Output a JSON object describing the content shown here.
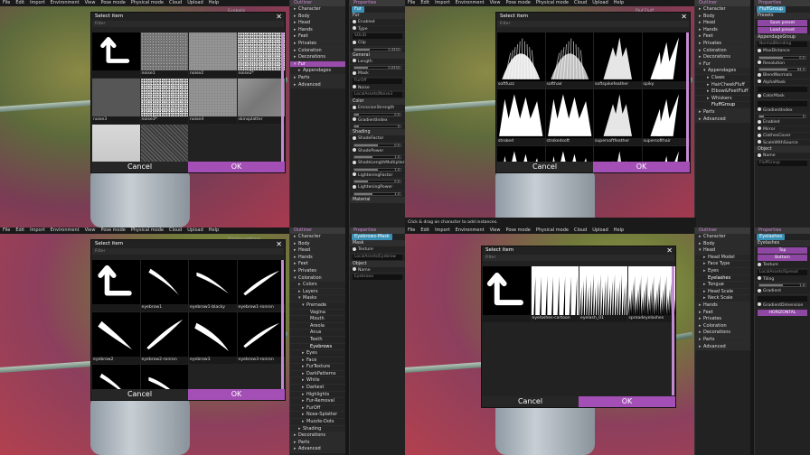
{
  "menu": [
    "File",
    "Edit",
    "Import",
    "Environment",
    "View",
    "Pose mode",
    "Physical mode",
    "Cloud",
    "Upload",
    "Help"
  ],
  "colors": {
    "accent": "#a34fb5",
    "selected": "#9a4cac",
    "chip": "#3a8fb5",
    "panel": "#222222"
  },
  "panels": {
    "outliner": "Outliner",
    "properties": "Properties"
  },
  "common": {
    "cancel": "Cancel",
    "ok": "OK",
    "filter": "Filter",
    "dialog_title": "Select item",
    "close": "✕"
  },
  "q0": {
    "outliner": [
      {
        "label": "Character",
        "level": 0,
        "chev": "▸"
      },
      {
        "label": "Body",
        "level": 0,
        "chev": "▸"
      },
      {
        "label": "Head",
        "level": 0,
        "chev": "▸"
      },
      {
        "label": "Hands",
        "level": 0,
        "chev": "▸"
      },
      {
        "label": "Feet",
        "level": 0,
        "chev": "▸"
      },
      {
        "label": "Privates",
        "level": 0,
        "chev": "▸"
      },
      {
        "label": "Coloration",
        "level": 0,
        "chev": "▸"
      },
      {
        "label": "Decorations",
        "level": 0,
        "chev": "▸"
      },
      {
        "label": "Fur",
        "level": 0,
        "chev": "▾",
        "selected": true
      },
      {
        "label": "Appendages",
        "level": 1,
        "chev": "▸"
      },
      {
        "label": "Parts",
        "level": 0,
        "chev": "▸"
      },
      {
        "label": "Advanced",
        "level": 0,
        "chev": "▸"
      }
    ],
    "props_chip": "Fur",
    "props": [
      {
        "type": "sect",
        "label": "Fur"
      },
      {
        "type": "row",
        "label": "Enabled"
      },
      {
        "type": "row",
        "label": "Type"
      },
      {
        "type": "field",
        "label": "SOLID"
      },
      {
        "type": "row",
        "label": "Clip"
      },
      {
        "type": "bar",
        "value": 0.3333,
        "text": "0.3333"
      },
      {
        "type": "sect",
        "label": "General"
      },
      {
        "type": "row",
        "label": "Length"
      },
      {
        "type": "bar",
        "value": 0.3,
        "text": "0.0334"
      },
      {
        "type": "row",
        "label": "Mask"
      },
      {
        "type": "field",
        "label": "FurOff"
      },
      {
        "type": "row",
        "label": "Noise"
      },
      {
        "type": "field",
        "label": "LocalAssets/Noise3"
      },
      {
        "type": "sect",
        "label": "Color"
      },
      {
        "type": "row",
        "label": "EmissionStrength"
      },
      {
        "type": "bar",
        "value": 0.1,
        "text": "0.0"
      },
      {
        "type": "row",
        "label": "GradientIndex"
      },
      {
        "type": "bar",
        "value": 0.1,
        "text": "0"
      },
      {
        "type": "sect",
        "label": "Shading"
      },
      {
        "type": "row",
        "label": "ShadeFactor"
      },
      {
        "type": "bar",
        "value": 0.5,
        "text": "0.5"
      },
      {
        "type": "row",
        "label": "ShadePower"
      },
      {
        "type": "bar",
        "value": 0.4,
        "text": "1.0"
      },
      {
        "type": "row",
        "label": "ShadeLengthMultiplier"
      },
      {
        "type": "bar",
        "value": 0.5,
        "text": "1.0"
      },
      {
        "type": "row",
        "label": "LighteningFactor"
      },
      {
        "type": "bar",
        "value": 0.3,
        "text": "0.0"
      },
      {
        "type": "row",
        "label": "LighteningPower"
      },
      {
        "type": "bar",
        "value": 0.4,
        "text": "1.0"
      },
      {
        "type": "sect",
        "label": "Material"
      }
    ],
    "behind_label": "Eyeballs",
    "dialog": {
      "items": [
        {
          "label": "",
          "kind": "arrow"
        },
        {
          "label": "noise1",
          "kind": "grain1"
        },
        {
          "label": "noise2",
          "kind": "grain2"
        },
        {
          "label": "noise2*",
          "kind": "grain3"
        },
        {
          "label": "noise3",
          "kind": "grain7"
        },
        {
          "label": "noise3*",
          "kind": "grain3"
        },
        {
          "label": "noise4",
          "kind": "grain2"
        },
        {
          "label": "skinsplatter",
          "kind": "grain5"
        },
        {
          "label": "",
          "kind": "grain6"
        },
        {
          "label": "",
          "kind": "grain4"
        }
      ]
    }
  },
  "q1": {
    "outliner": [
      {
        "label": "Character",
        "level": 0,
        "chev": "▸"
      },
      {
        "label": "Body",
        "level": 0,
        "chev": "▸"
      },
      {
        "label": "Head",
        "level": 0,
        "chev": "▸"
      },
      {
        "label": "Hands",
        "level": 0,
        "chev": "▸"
      },
      {
        "label": "Feet",
        "level": 0,
        "chev": "▸"
      },
      {
        "label": "Privates",
        "level": 0,
        "chev": "▸"
      },
      {
        "label": "Coloration",
        "level": 0,
        "chev": "▸"
      },
      {
        "label": "Decorations",
        "level": 0,
        "chev": "▸"
      },
      {
        "label": "Fur",
        "level": 0,
        "chev": "▾"
      },
      {
        "label": "Appendages",
        "level": 1,
        "chev": "▾"
      },
      {
        "label": "Claws",
        "level": 2,
        "chev": "▸"
      },
      {
        "label": "HairCheekFluff",
        "level": 2,
        "chev": "▸"
      },
      {
        "label": "Elbow&FeetFluff",
        "level": 2,
        "chev": "▸"
      },
      {
        "label": "Whiskers",
        "level": 2,
        "chev": "▸"
      },
      {
        "label": "FluffGroup",
        "level": 2,
        "chev": "",
        "selected": true
      },
      {
        "label": "Parts",
        "level": 0,
        "chev": "▸"
      },
      {
        "label": "Advanced",
        "level": 0,
        "chev": "▸"
      }
    ],
    "props_chip": "FluffGroup",
    "props": [
      {
        "type": "sect",
        "label": "Presets"
      },
      {
        "type": "btn",
        "label": "Save preset"
      },
      {
        "type": "btn",
        "label": "Load preset"
      },
      {
        "type": "sect",
        "label": "AppendageGroup"
      },
      {
        "type": "field",
        "label": "NormalBlending"
      },
      {
        "type": "row",
        "label": "MaxDistance"
      },
      {
        "type": "bar",
        "value": 0.5,
        "text": "0.5"
      },
      {
        "type": "row",
        "label": "Resolution"
      },
      {
        "type": "bar",
        "value": 0.6,
        "text": "64.0"
      },
      {
        "type": "row",
        "label": "BlendNormals"
      },
      {
        "type": "row",
        "label": "AlphaMask"
      },
      {
        "type": "field",
        "label": ""
      },
      {
        "type": "row",
        "label": "ColorMask"
      },
      {
        "type": "field",
        "label": ""
      },
      {
        "type": "row",
        "label": "GradientIndex"
      },
      {
        "type": "bar",
        "value": 0.1,
        "text": "0"
      },
      {
        "type": "row",
        "label": "Enabled"
      },
      {
        "type": "row",
        "label": "Mirror"
      },
      {
        "type": "row",
        "label": "ClothesCover"
      },
      {
        "type": "row",
        "label": "ScaleWithSource"
      },
      {
        "type": "sect",
        "label": "Object"
      },
      {
        "type": "row",
        "label": "Name"
      },
      {
        "type": "field",
        "label": "FluffGroup"
      }
    ],
    "behind_label": "Pluf Fluff",
    "status": "Click & drag on character to add instances.",
    "dialog": {
      "items": [
        {
          "label": "softfuzz",
          "kind": "fur1"
        },
        {
          "label": "softhair",
          "kind": "fur2"
        },
        {
          "label": "softspikefeather",
          "kind": "fur3"
        },
        {
          "label": "spiky",
          "kind": "fur4"
        },
        {
          "label": "stroked",
          "kind": "fur5"
        },
        {
          "label": "strokedsoft",
          "kind": "fur6"
        },
        {
          "label": "supersoftfeather",
          "kind": "fur7"
        },
        {
          "label": "supersofthair",
          "kind": "fur8"
        },
        {
          "label": "",
          "kind": "fur5"
        },
        {
          "label": "",
          "kind": "fur6"
        },
        {
          "label": "",
          "kind": "fur3"
        },
        {
          "label": "",
          "kind": "fur4"
        }
      ]
    }
  },
  "q2": {
    "outliner": [
      {
        "label": "Character",
        "level": 0,
        "chev": "▸"
      },
      {
        "label": "Body",
        "level": 0,
        "chev": "▸"
      },
      {
        "label": "Head",
        "level": 0,
        "chev": "▸"
      },
      {
        "label": "Hands",
        "level": 0,
        "chev": "▸"
      },
      {
        "label": "Feet",
        "level": 0,
        "chev": "▸"
      },
      {
        "label": "Privates",
        "level": 0,
        "chev": "▸"
      },
      {
        "label": "Coloration",
        "level": 0,
        "chev": "▾"
      },
      {
        "label": "Colors",
        "level": 1,
        "chev": "▸"
      },
      {
        "label": "Layers",
        "level": 1,
        "chev": "▸"
      },
      {
        "label": "Masks",
        "level": 1,
        "chev": "▾"
      },
      {
        "label": "Premade",
        "level": 2,
        "chev": "▾"
      },
      {
        "label": "Vagina",
        "level": 3,
        "chev": ""
      },
      {
        "label": "Mouth",
        "level": 3,
        "chev": ""
      },
      {
        "label": "Areola",
        "level": 3,
        "chev": ""
      },
      {
        "label": "Anus",
        "level": 3,
        "chev": ""
      },
      {
        "label": "Teeth",
        "level": 3,
        "chev": ""
      },
      {
        "label": "Eyebrows",
        "level": 3,
        "chev": "",
        "selected": true
      },
      {
        "label": "Eyes",
        "level": 2,
        "chev": "▸"
      },
      {
        "label": "Face",
        "level": 2,
        "chev": "▸"
      },
      {
        "label": "FurTexture",
        "level": 2,
        "chev": "▸"
      },
      {
        "label": "DarkPatterns",
        "level": 2,
        "chev": "▸"
      },
      {
        "label": "White",
        "level": 2,
        "chev": "▸"
      },
      {
        "label": "Darkest",
        "level": 2,
        "chev": "▸"
      },
      {
        "label": "Highlights",
        "level": 2,
        "chev": "▸"
      },
      {
        "label": "Fur-Removal",
        "level": 2,
        "chev": "▸"
      },
      {
        "label": "FurOff",
        "level": 2,
        "chev": "▸"
      },
      {
        "label": "Nose-Splatter",
        "level": 2,
        "chev": "▸"
      },
      {
        "label": "Muzzle-Dots",
        "level": 2,
        "chev": "▸"
      },
      {
        "label": "Shading",
        "level": 1,
        "chev": "▸"
      },
      {
        "label": "Decorations",
        "level": 0,
        "chev": "▸"
      },
      {
        "label": "Parts",
        "level": 0,
        "chev": "▸"
      },
      {
        "label": "Advanced",
        "level": 0,
        "chev": "▸"
      }
    ],
    "props_chip": "Eyebrows-Mask",
    "props": [
      {
        "type": "sect",
        "label": "Mask"
      },
      {
        "type": "row",
        "label": "Texture"
      },
      {
        "type": "field",
        "label": "LocalAssets/Eyebrow"
      },
      {
        "type": "sect",
        "label": "Object"
      },
      {
        "type": "row",
        "label": "Name"
      },
      {
        "type": "field",
        "label": "Eyebrows"
      }
    ],
    "behind_label": "Display settings",
    "dialog": {
      "items": [
        {
          "label": "",
          "kind": "arrow"
        },
        {
          "label": "eyebrow1",
          "kind": "brow1"
        },
        {
          "label": "eyebrow1-blacky",
          "kind": "brow2"
        },
        {
          "label": "eyebrow1-ronron",
          "kind": "brow3"
        },
        {
          "label": "eyebrow2",
          "kind": "brow4"
        },
        {
          "label": "eyebrow2-ronron",
          "kind": "brow5"
        },
        {
          "label": "eyebrow3",
          "kind": "brow6"
        },
        {
          "label": "eyebrow3-ronron",
          "kind": "brow3"
        },
        {
          "label": "",
          "kind": "brow1"
        },
        {
          "label": "",
          "kind": "brow2"
        }
      ]
    }
  },
  "q3": {
    "outliner": [
      {
        "label": "Character",
        "level": 0,
        "chev": "▸"
      },
      {
        "label": "Body",
        "level": 0,
        "chev": "▸"
      },
      {
        "label": "Head",
        "level": 0,
        "chev": "▾"
      },
      {
        "label": "Head Model",
        "level": 1,
        "chev": "▸"
      },
      {
        "label": "Face Type",
        "level": 1,
        "chev": "▸"
      },
      {
        "label": "Eyes",
        "level": 1,
        "chev": "▸"
      },
      {
        "label": "Eyelashes",
        "level": 1,
        "chev": "",
        "selected": true
      },
      {
        "label": "Tongue",
        "level": 1,
        "chev": "▸"
      },
      {
        "label": "Head Scale",
        "level": 1,
        "chev": "▸"
      },
      {
        "label": "Neck Scale",
        "level": 1,
        "chev": "▸"
      },
      {
        "label": "Hands",
        "level": 0,
        "chev": "▸"
      },
      {
        "label": "Feet",
        "level": 0,
        "chev": "▸"
      },
      {
        "label": "Privates",
        "level": 0,
        "chev": "▸"
      },
      {
        "label": "Coloration",
        "level": 0,
        "chev": "▸"
      },
      {
        "label": "Decorations",
        "level": 0,
        "chev": "▸"
      },
      {
        "label": "Parts",
        "level": 0,
        "chev": "▸"
      },
      {
        "label": "Advanced",
        "level": 0,
        "chev": "▸"
      }
    ],
    "props_chip": "Eyelashes",
    "props": [
      {
        "type": "sect",
        "label": "Eyelashes"
      },
      {
        "type": "btn",
        "label": "Top"
      },
      {
        "type": "btn",
        "label": "Bottom"
      },
      {
        "type": "row",
        "label": "Texture"
      },
      {
        "type": "field",
        "label": "LocalAssets/Spread"
      },
      {
        "type": "row",
        "label": "Tiling"
      },
      {
        "type": "bar",
        "value": 0.5,
        "text": "1.0"
      },
      {
        "type": "row",
        "label": "Gradient"
      },
      {
        "type": "field",
        "label": ""
      },
      {
        "type": "row",
        "label": "GradientDimension"
      },
      {
        "type": "btn",
        "label": "HORIZONTAL"
      }
    ],
    "dialog": {
      "items": [
        {
          "label": "",
          "kind": "arrow"
        },
        {
          "label": "eyelashes-cartoon",
          "kind": "lash1"
        },
        {
          "label": "eyelash_01",
          "kind": "lash2"
        },
        {
          "label": "spreadeyelashes",
          "kind": "lash3"
        }
      ]
    }
  }
}
